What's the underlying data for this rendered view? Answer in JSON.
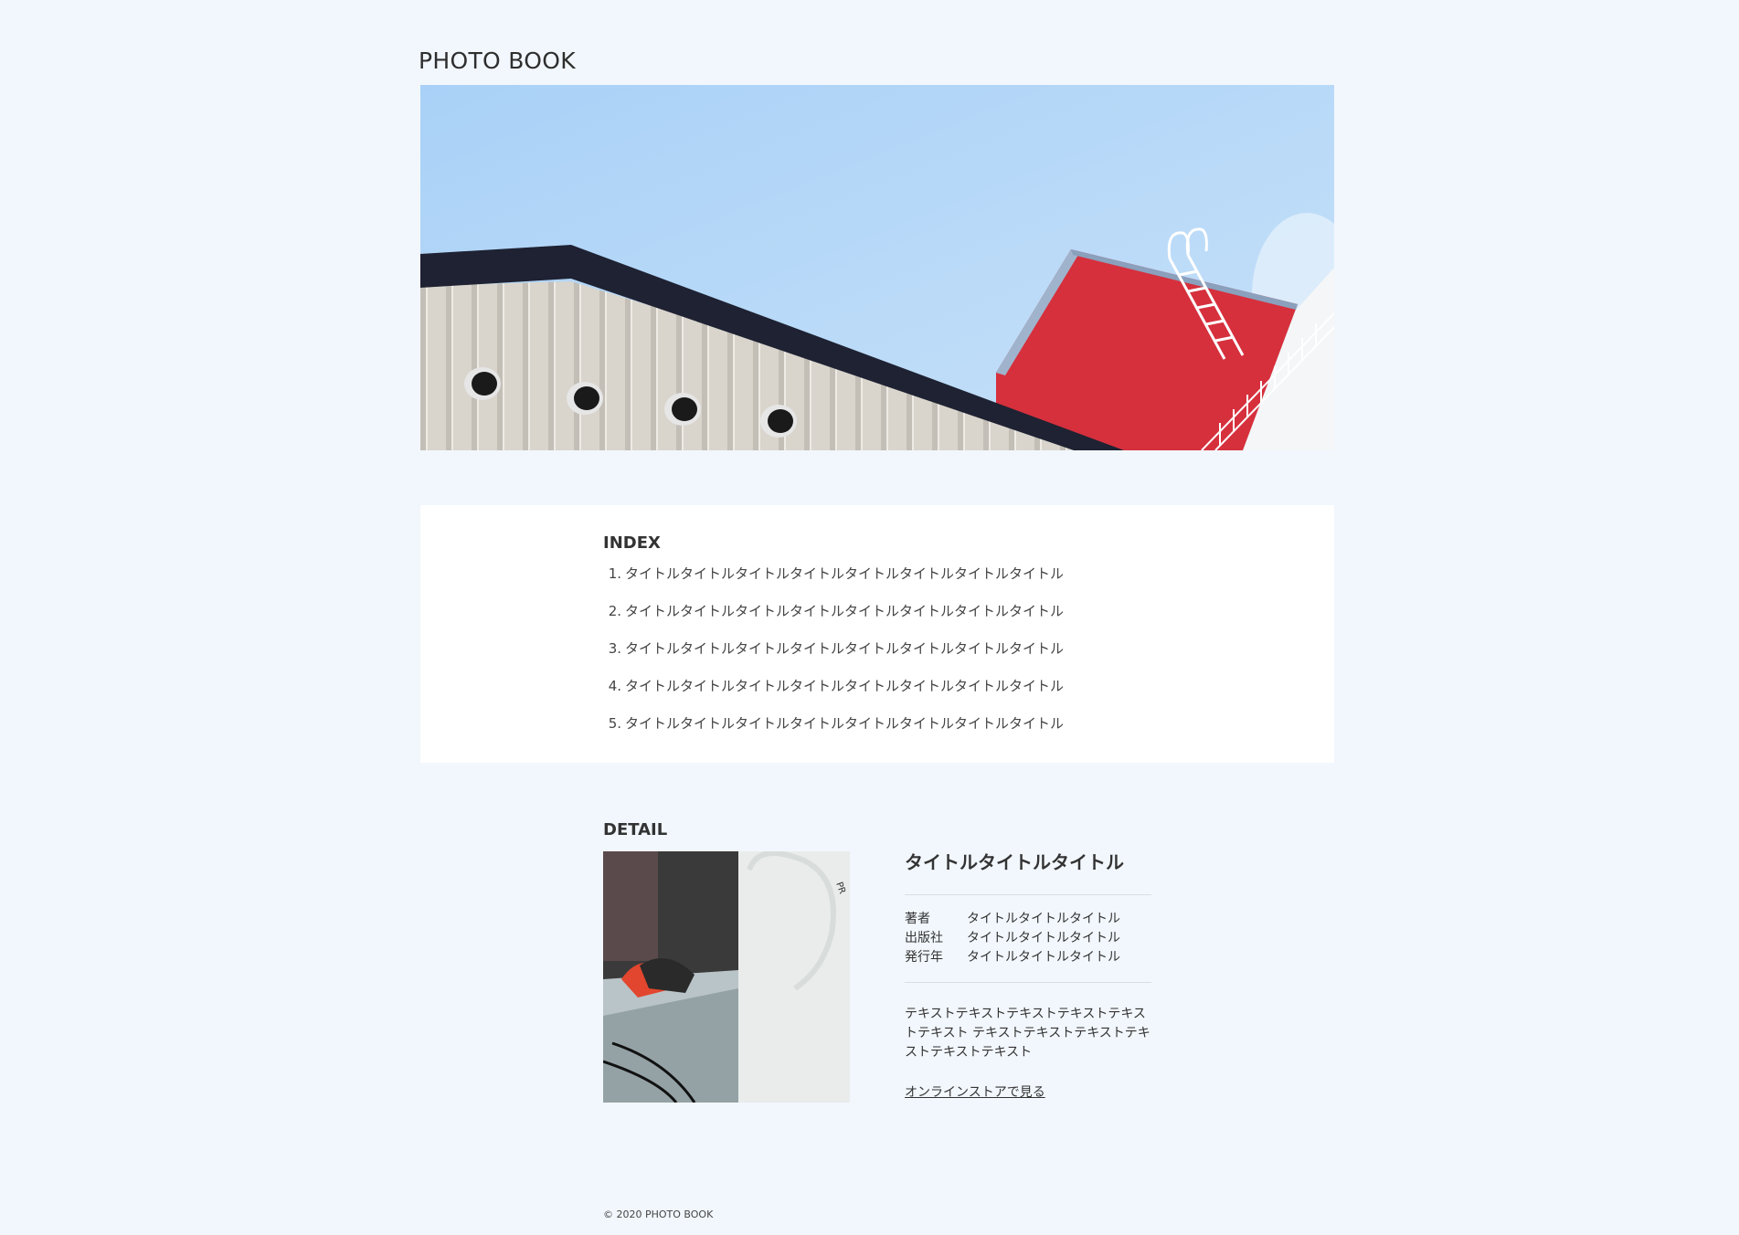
{
  "header": {
    "site_title": "PHOTO BOOK"
  },
  "hero": {
    "image": "building-rooftop-photo",
    "colors": {
      "sky": "#b4d6f7",
      "roof": "#1d2130",
      "wall": "#d8d4cc",
      "red_building": "#d8303d"
    }
  },
  "index": {
    "heading": "INDEX",
    "items": [
      {
        "number": "1.",
        "title": "タイトルタイトルタイトルタイトルタイトルタイトルタイトルタイトル"
      },
      {
        "number": "2.",
        "title": "タイトルタイトルタイトルタイトルタイトルタイトルタイトルタイトル"
      },
      {
        "number": "3.",
        "title": "タイトルタイトルタイトルタイトルタイトルタイトルタイトルタイトル"
      },
      {
        "number": "4.",
        "title": "タイトルタイトルタイトルタイトルタイトルタイトルタイトルタイトル"
      },
      {
        "number": "5.",
        "title": "タイトルタイトルタイトルタイトルタイトルタイトルタイトルタイトル"
      }
    ]
  },
  "detail": {
    "heading": "DETAIL",
    "image": "book-cover-photo",
    "book_title": "タイトルタイトルタイトル",
    "meta": [
      {
        "label": "著者",
        "value": "タイトルタイトルタイトル"
      },
      {
        "label": "出版社",
        "value": "タイトルタイトルタイトル"
      },
      {
        "label": "発行年",
        "value": "タイトルタイトルタイトル"
      }
    ],
    "description": "テキストテキストテキストテキストテキストテキスト テキストテキストテキストテキストテキストテキスト",
    "store_link": "オンラインストアで見る"
  },
  "footer": {
    "copyright": "© 2020 PHOTO BOOK"
  }
}
